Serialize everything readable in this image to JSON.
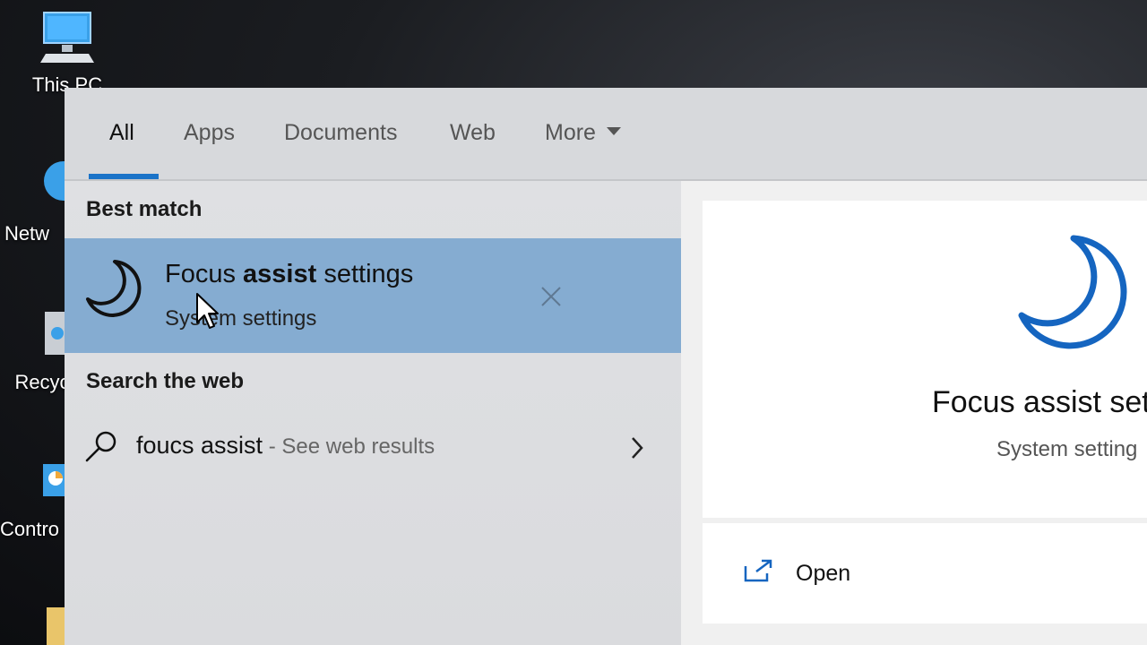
{
  "desktop": {
    "icons": [
      {
        "label": "This PC",
        "icon": "computer-icon"
      },
      {
        "label": "Netw",
        "icon": "network-icon"
      },
      {
        "label": "Recyc",
        "icon": "recycle-bin-icon"
      },
      {
        "label": "Contro",
        "icon": "control-panel-icon"
      }
    ]
  },
  "tabs": [
    {
      "label": "All",
      "active": true
    },
    {
      "label": "Apps"
    },
    {
      "label": "Documents"
    },
    {
      "label": "Web"
    },
    {
      "label": "More"
    }
  ],
  "best_match": {
    "heading": "Best match",
    "title_prefix": "Focus ",
    "title_bold": "assist",
    "title_suffix": " settings",
    "subtitle": "System settings",
    "icon": "moon-icon"
  },
  "search_web": {
    "heading": "Search the web",
    "query": "foucs assist",
    "suffix": " - See web results"
  },
  "detail": {
    "title": "Focus assist set",
    "subtitle": "System setting",
    "actions": [
      {
        "label": "Open",
        "icon": "open-window-icon"
      }
    ]
  },
  "colors": {
    "accent": "#1a73c8",
    "highlight": "#85acd1",
    "moon_blue": "#1565c0"
  }
}
